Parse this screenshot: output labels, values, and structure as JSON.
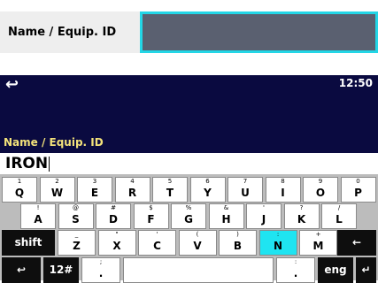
{
  "field": {
    "label": "Name / Equip. ID"
  },
  "header": {
    "back_icon": "↩",
    "time": "12:50",
    "label": "Name / Equip. ID"
  },
  "input": {
    "value": "IRON"
  },
  "keyboard": {
    "row1": [
      {
        "main": "Q",
        "sub": "1"
      },
      {
        "main": "W",
        "sub": "2"
      },
      {
        "main": "E",
        "sub": "3"
      },
      {
        "main": "R",
        "sub": "4"
      },
      {
        "main": "T",
        "sub": "5"
      },
      {
        "main": "Y",
        "sub": "6"
      },
      {
        "main": "U",
        "sub": "7"
      },
      {
        "main": "I",
        "sub": "8"
      },
      {
        "main": "O",
        "sub": "9"
      },
      {
        "main": "P",
        "sub": "0"
      }
    ],
    "row2": [
      {
        "main": "A",
        "sub": "!"
      },
      {
        "main": "S",
        "sub": "@"
      },
      {
        "main": "D",
        "sub": "#"
      },
      {
        "main": "F",
        "sub": "$"
      },
      {
        "main": "G",
        "sub": "%"
      },
      {
        "main": "H",
        "sub": "&"
      },
      {
        "main": "J",
        "sub": "'"
      },
      {
        "main": "K",
        "sub": "?"
      },
      {
        "main": "L",
        "sub": "/"
      }
    ],
    "row3": [
      {
        "main": "Z",
        "sub": "_"
      },
      {
        "main": "X",
        "sub": "\""
      },
      {
        "main": "C",
        "sub": "'"
      },
      {
        "main": "V",
        "sub": "("
      },
      {
        "main": "B",
        "sub": ")"
      },
      {
        "main": "N",
        "sub": ":"
      },
      {
        "main": "M",
        "sub": "+"
      }
    ],
    "shift_label": "shift",
    "backspace_icon": "←",
    "bottom_back_icon": "↩",
    "numsym_label": "12#",
    "dot_label": ".",
    "dot_sub": ";",
    "dot2_label": ".",
    "dot2_sub": ":",
    "lang_label": "eng",
    "enter_icon": "↵"
  },
  "colors": {
    "accent": "#1fe4f1",
    "panel": "#0a0a40",
    "label_yellow": "#f3e27a"
  }
}
